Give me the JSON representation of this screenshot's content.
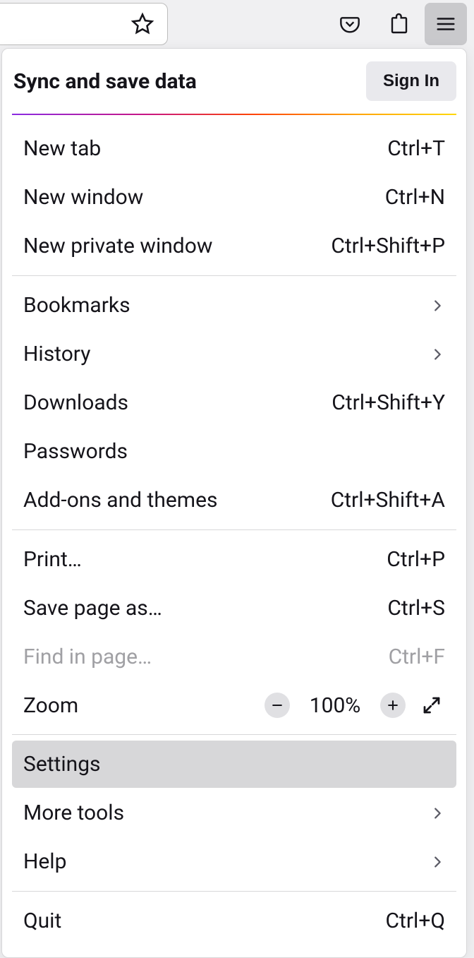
{
  "toolbar": {
    "pocket_icon": "pocket-icon",
    "extensions_icon": "extensions-icon",
    "hamburger_icon": "hamburger-icon",
    "star_icon": "bookmark-star-icon"
  },
  "sync": {
    "title": "Sync and save data",
    "signin_label": "Sign In"
  },
  "menu": {
    "group1": [
      {
        "label": "New tab",
        "shortcut": "Ctrl+T"
      },
      {
        "label": "New window",
        "shortcut": "Ctrl+N"
      },
      {
        "label": "New private window",
        "shortcut": "Ctrl+Shift+P"
      }
    ],
    "group2": [
      {
        "label": "Bookmarks",
        "submenu": true
      },
      {
        "label": "History",
        "submenu": true
      },
      {
        "label": "Downloads",
        "shortcut": "Ctrl+Shift+Y"
      },
      {
        "label": "Passwords"
      },
      {
        "label": "Add-ons and themes",
        "shortcut": "Ctrl+Shift+A"
      }
    ],
    "group3": [
      {
        "label": "Print…",
        "shortcut": "Ctrl+P"
      },
      {
        "label": "Save page as…",
        "shortcut": "Ctrl+S"
      },
      {
        "label": "Find in page…",
        "shortcut": "Ctrl+F",
        "disabled": true
      }
    ],
    "zoom": {
      "label": "Zoom",
      "value": "100%"
    },
    "group4": [
      {
        "label": "Settings",
        "highlight": true
      },
      {
        "label": "More tools",
        "submenu": true
      },
      {
        "label": "Help",
        "submenu": true
      }
    ],
    "group5": [
      {
        "label": "Quit",
        "shortcut": "Ctrl+Q"
      }
    ]
  }
}
